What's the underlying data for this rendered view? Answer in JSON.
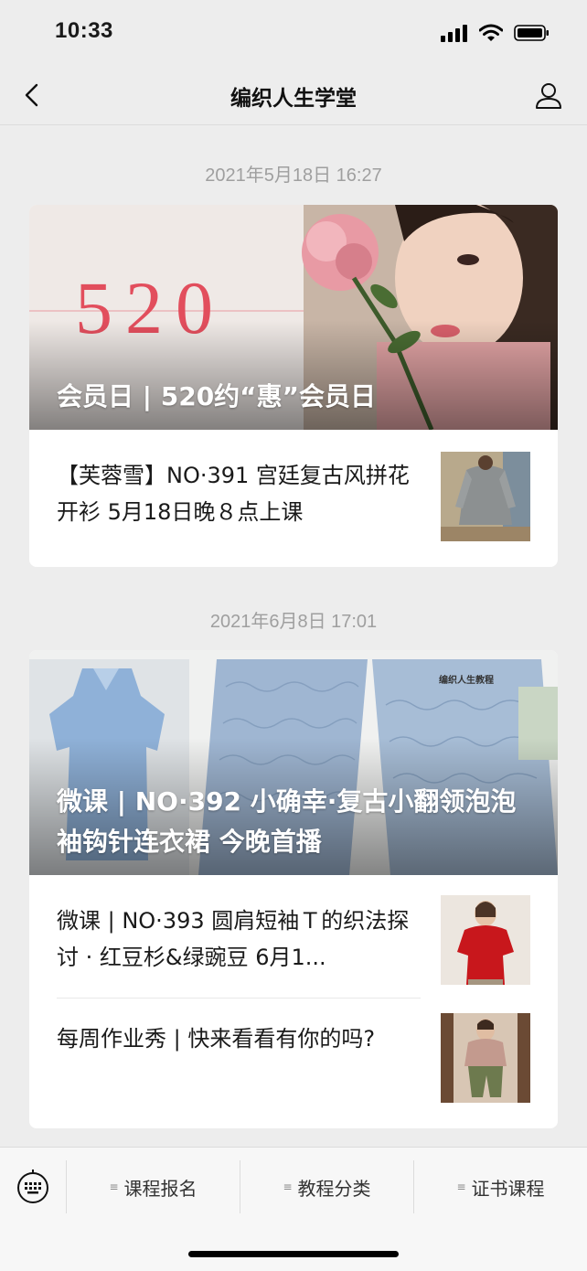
{
  "status_bar": {
    "time": "10:33"
  },
  "nav": {
    "title": "编织人生学堂",
    "back_icon": "chevron-left-icon",
    "user_icon": "person-icon"
  },
  "messages": [
    {
      "date": "2021年5月18日 16:27",
      "cover": {
        "title": "会员日 | 520约“惠”会员日",
        "overlay_text": "520"
      },
      "items": [
        {
          "title": "【芙蓉雪】NO·391 宫廷复古风拼花开衫 5月18日晚８点上课"
        }
      ]
    },
    {
      "date": "2021年6月8日 17:01",
      "cover": {
        "title": "微课 | NO·392 小确幸·复古小翻领泡泡袖钩针连衣裙 今晚首播",
        "overlay_text": "编织人生教程"
      },
      "items": [
        {
          "title": "微课 | NO·393 圆肩短袖Ｔ的织法探讨 · 红豆杉&绿豌豆 6月1..."
        },
        {
          "title": "每周作业秀 | 快来看看有你的吗?"
        }
      ]
    }
  ],
  "bottom_menu": {
    "keyboard_icon": "keyboard-icon",
    "items": [
      {
        "label": "课程报名"
      },
      {
        "label": "教程分类"
      },
      {
        "label": "证书课程"
      }
    ]
  },
  "colors": {
    "background": "#ededed",
    "card": "#ffffff",
    "date_text": "#9f9f9f"
  }
}
